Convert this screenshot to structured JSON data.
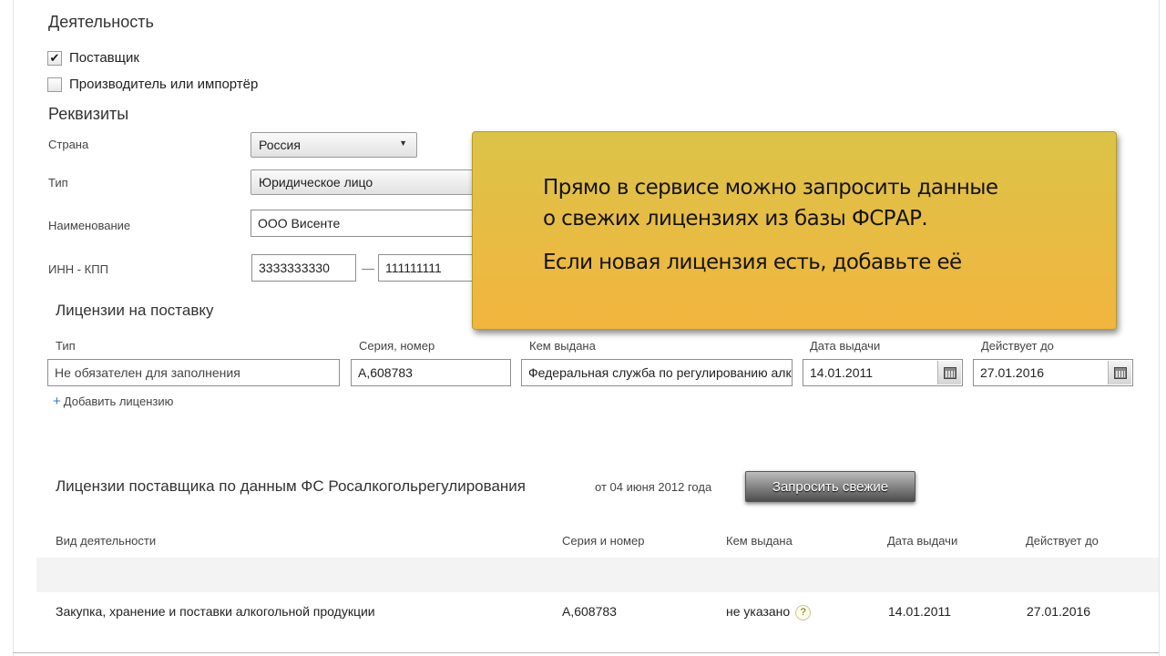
{
  "activity": {
    "title": "Деятельность",
    "supplier_label": "Поставщик",
    "supplier_checked": true,
    "producer_label": "Производитель или импортёр",
    "producer_checked": false
  },
  "requisites": {
    "title": "Реквизиты",
    "country_label": "Страна",
    "country_value": "Россия",
    "type_label": "Тип",
    "type_value": "Юридическое лицо",
    "name_label": "Наименование",
    "name_value": "ООО Висенте",
    "inn_kpp_label": "ИНН - КПП",
    "inn_value": "3333333330",
    "separator": "—",
    "kpp_value": "111111111"
  },
  "supply_licenses": {
    "title": "Лицензии на поставку",
    "columns": {
      "type": "Тип",
      "series": "Серия, номер",
      "issuer": "Кем выдана",
      "issue_date": "Дата выдачи",
      "valid_until": "Действует до"
    },
    "row": {
      "type_placeholder": "Не обязателен для заполнения",
      "series": "А,608783",
      "issuer": "Федеральная служба по регулированию алкогольного рынка",
      "issue_date": "14.01.2011",
      "valid_until": "27.01.2016"
    },
    "add_link": "Добавить лицензию"
  },
  "fsrar_licenses": {
    "title": "Лицензии поставщика по данным ФС Росалкогольрегулирования",
    "date_note": "от 04 июня 2012 года",
    "request_button": "Запросить свежие",
    "columns": {
      "activity": "Вид деятельности",
      "series": "Серия и номер",
      "issuer": "Кем выдана",
      "issue_date": "Дата выдачи",
      "valid_until": "Действует до"
    },
    "rows": [
      {
        "activity": "Закупка, хранение и поставки алкогольной продукции",
        "series": "А,608783",
        "issuer": "не указано",
        "issue_date": "14.01.2011",
        "valid_until": "27.01.2016"
      }
    ]
  },
  "tooltip": {
    "line1": "Прямо в сервисе можно запросить данные",
    "line2": "о свежих лицензиях из базы ФСРАР.",
    "line3": "Если новая лицензия есть, добавьте её"
  },
  "icons": {
    "checkbox_mark": "✔",
    "dropdown_arrow": "▼",
    "plus": "+",
    "help": "?"
  },
  "colors": {
    "tooltip_top": "#dcc348",
    "tooltip_bottom": "#f2b53e",
    "link_plus": "#3a78c2",
    "button_dark": "#4d4d4d"
  }
}
